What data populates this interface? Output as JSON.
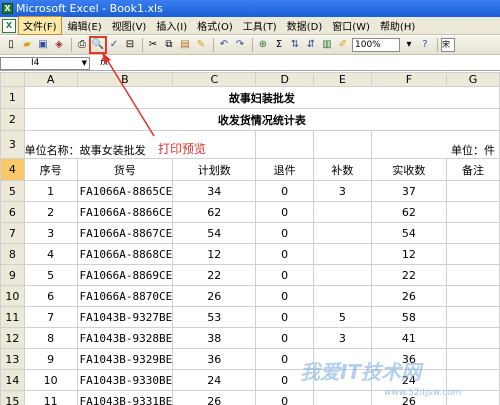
{
  "window": {
    "title": "Microsoft Excel - Book1.xls",
    "app_icon": "X"
  },
  "menu": {
    "doc_icon": "X",
    "items": [
      {
        "label": "文件(F)",
        "active": true
      },
      {
        "label": "编辑(E)"
      },
      {
        "label": "视图(V)"
      },
      {
        "label": "插入(I)"
      },
      {
        "label": "格式(O)"
      },
      {
        "label": "工具(T)"
      },
      {
        "label": "数据(D)"
      },
      {
        "label": "窗口(W)"
      },
      {
        "label": "帮助(H)"
      }
    ]
  },
  "toolbar": {
    "zoom": "100%",
    "font_box": "宋"
  },
  "formula_bar": {
    "cell_ref": "I4",
    "fx": "fx"
  },
  "columns": [
    "A",
    "B",
    "C",
    "D",
    "E",
    "F",
    "G"
  ],
  "rows": [
    "1",
    "2",
    "3",
    "4",
    "5",
    "6",
    "7",
    "8",
    "9",
    "10",
    "11",
    "12",
    "13",
    "14",
    "15"
  ],
  "sheet": {
    "title1": "故事妇装批发",
    "title2": "收发货情况统计表",
    "unit_name_label": "单位名称：故事女装批发",
    "unit_label": "单位：件",
    "headers": [
      "序号",
      "货号",
      "计划数",
      "退件",
      "补数",
      "实收数",
      "备注"
    ],
    "data": [
      [
        "1",
        "FA1066A-8865CE",
        "34",
        "0",
        "3",
        "37",
        ""
      ],
      [
        "2",
        "FA1066A-8866CE",
        "62",
        "0",
        "",
        "62",
        ""
      ],
      [
        "3",
        "FA1066A-8867CE",
        "54",
        "0",
        "",
        "54",
        ""
      ],
      [
        "4",
        "FA1066A-8868CE",
        "12",
        "0",
        "",
        "12",
        ""
      ],
      [
        "5",
        "FA1066A-8869CE",
        "22",
        "0",
        "",
        "22",
        ""
      ],
      [
        "6",
        "FA1066A-8870CE",
        "26",
        "0",
        "",
        "26",
        ""
      ],
      [
        "7",
        "FA1043B-9327BE",
        "53",
        "0",
        "5",
        "58",
        ""
      ],
      [
        "8",
        "FA1043B-9328BE",
        "38",
        "0",
        "3",
        "41",
        ""
      ],
      [
        "9",
        "FA1043B-9329BE",
        "36",
        "0",
        "",
        "36",
        ""
      ],
      [
        "10",
        "FA1043B-9330BE",
        "24",
        "0",
        "",
        "24",
        ""
      ],
      [
        "11",
        "FA1043B-9331BE",
        "26",
        "0",
        "",
        "26",
        ""
      ]
    ]
  },
  "annotation": {
    "text": "打印预览",
    "color": "#e0302a"
  },
  "watermark": {
    "text": "我爱IT技术网",
    "url": "www.52itjsw.com"
  }
}
